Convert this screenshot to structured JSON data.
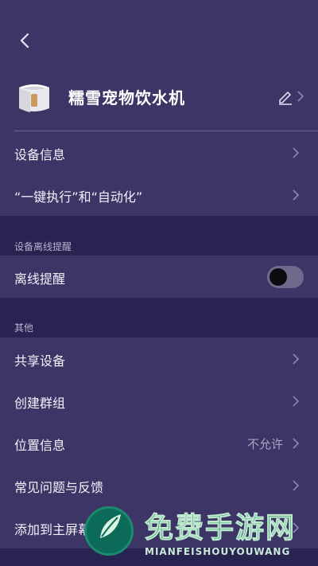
{
  "device": {
    "name": "糯雪宠物饮水机",
    "image_icon": "water-fountain-device"
  },
  "menu_top": [
    {
      "label": "设备信息"
    },
    {
      "label": "“一键执行”和“自动化”"
    }
  ],
  "offline_section": {
    "title": "设备离线提醒",
    "toggle_label": "离线提醒",
    "toggle_on": false
  },
  "other_section": {
    "title": "其他",
    "items": [
      {
        "label": "共享设备",
        "value": ""
      },
      {
        "label": "创建群组",
        "value": ""
      },
      {
        "label": "位置信息",
        "value": "不允许"
      },
      {
        "label": "常见问题与反馈",
        "value": ""
      },
      {
        "label": "添加到主屏幕",
        "value": ""
      }
    ]
  },
  "watermark": {
    "title": "免费手游网",
    "subtitle": "MIANFEISHOUYOUWANG"
  },
  "colors": {
    "background": "#282350",
    "row": "#3c3566",
    "accent_watermark": "#0f8a58"
  }
}
